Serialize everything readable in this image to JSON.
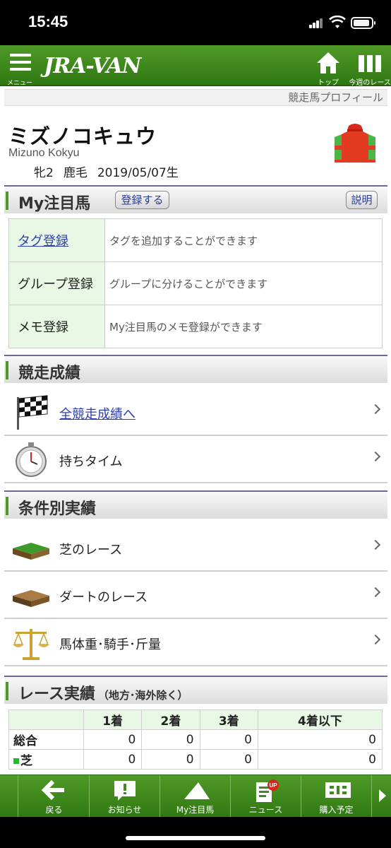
{
  "status": {
    "time": "15:45"
  },
  "topnav": {
    "menu_label": "メニュー",
    "logo": "JRA-VAN",
    "top_label": "トップ",
    "week_label": "今週のレース"
  },
  "breadcrumb": "競走馬プロフィール",
  "horse": {
    "name": "ミズノコキュウ",
    "roman": "Mizuno Kokyu",
    "sex_age": "牝2",
    "coat": "鹿毛",
    "birth": "2019/05/07生"
  },
  "my_horse": {
    "title": "My注目馬",
    "register_label": "登録する",
    "help_label": "説明",
    "rows": [
      {
        "key": "タグ登録",
        "desc": "タグを追加することができます"
      },
      {
        "key": "グループ登録",
        "desc": "グループに分けることができます"
      },
      {
        "key": "メモ登録",
        "desc": "My注目馬のメモ登録ができます"
      }
    ]
  },
  "race_record": {
    "title": "競走成績",
    "items": [
      {
        "label": "全競走成績へ",
        "icon": "checkered-flag-icon"
      },
      {
        "label": "持ちタイム",
        "icon": "stopwatch-icon"
      }
    ]
  },
  "conditions": {
    "title": "条件別実績",
    "items": [
      {
        "label": "芝のレース",
        "icon": "turf-icon"
      },
      {
        "label": "ダートのレース",
        "icon": "dirt-icon"
      },
      {
        "label": "馬体重･騎手･斤量",
        "icon": "scale-icon"
      }
    ]
  },
  "race_results": {
    "title": "レース実績",
    "subtitle": "（地方･海外除く）",
    "headers": [
      "",
      "1着",
      "2着",
      "3着",
      "4着以下"
    ],
    "rows": [
      {
        "label": "総合",
        "values": [
          "0",
          "0",
          "0",
          "0"
        ]
      },
      {
        "label": "芝",
        "values": [
          "0",
          "0",
          "0",
          "0"
        ]
      }
    ]
  },
  "bottomnav": {
    "items": [
      {
        "label": "戻る"
      },
      {
        "label": "お知らせ"
      },
      {
        "label": "My注目馬"
      },
      {
        "label": "ニュース",
        "badge": "UP"
      },
      {
        "label": "購入予定"
      }
    ]
  },
  "colors": {
    "green": "#3f8a1e",
    "link": "#2d3fb0",
    "header_border": "#6a6a9a"
  }
}
